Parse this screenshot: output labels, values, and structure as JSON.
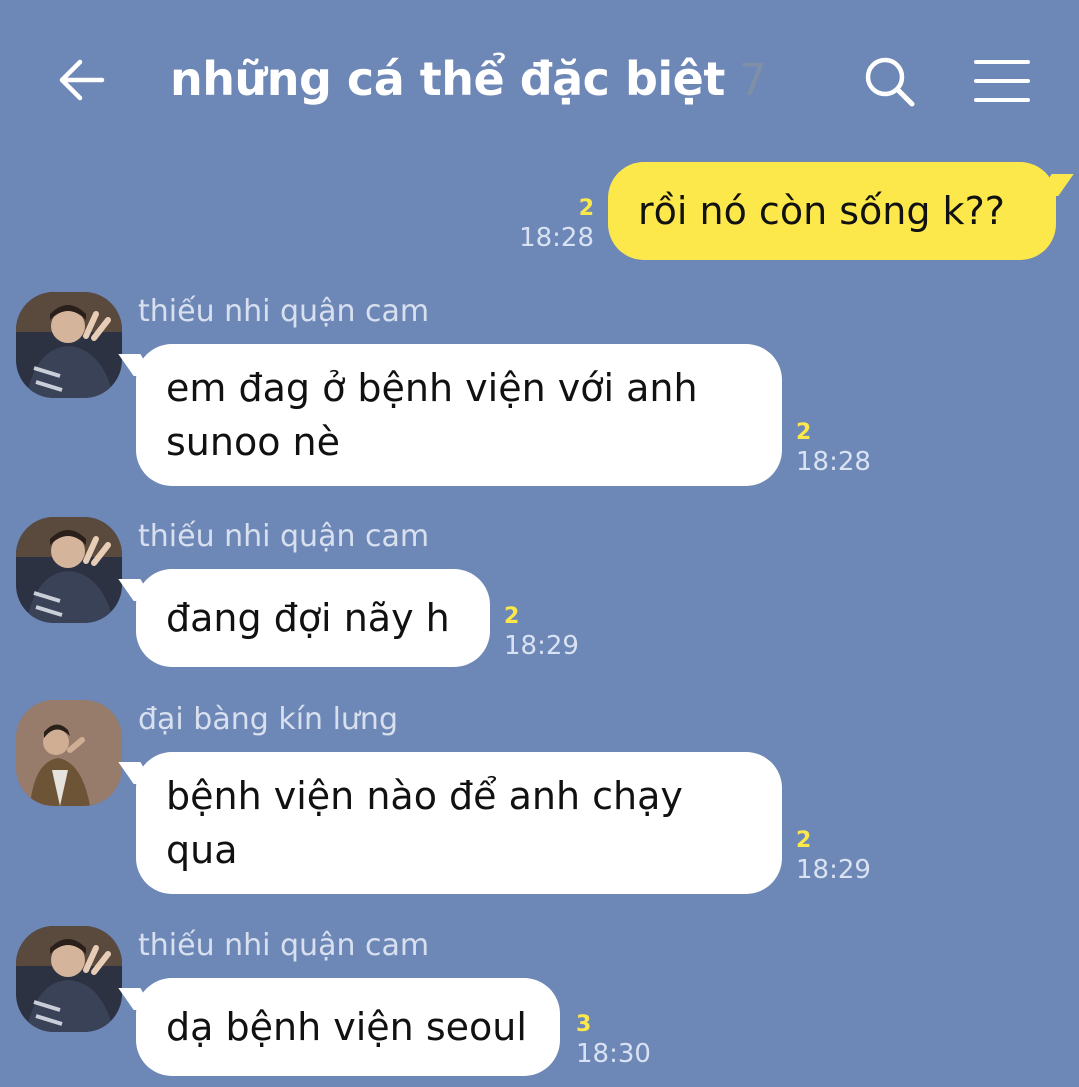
{
  "header": {
    "title": "những cá thể đặc biệt",
    "member_count": "7",
    "icons": {
      "back": "arrow-left-icon",
      "search": "search-icon",
      "menu": "hamburger-menu-icon"
    }
  },
  "colors": {
    "background": "#6d87b6",
    "my_bubble": "#fde84b",
    "their_bubble": "#ffffff",
    "unread": "#fde84b"
  },
  "messages": [
    {
      "from": "me",
      "text": "rồi nó còn sống k??",
      "unread": "2",
      "time": "18:28"
    },
    {
      "from": "thiếu nhi quận cam",
      "lines": [
        "em đag ở bệnh viện với anh",
        "sunoo nè"
      ],
      "unread": "2",
      "time": "18:28"
    },
    {
      "from": "thiếu nhi quận cam",
      "text": "đang đợi nãy h",
      "unread": "2",
      "time": "18:29"
    },
    {
      "from": "đại bàng kín lưng",
      "lines": [
        "bệnh viện nào để anh chạy",
        "qua"
      ],
      "unread": "2",
      "time": "18:29"
    },
    {
      "from": "thiếu nhi quận cam",
      "text": "dạ bệnh viện seoul",
      "unread": "3",
      "time": "18:30"
    }
  ]
}
